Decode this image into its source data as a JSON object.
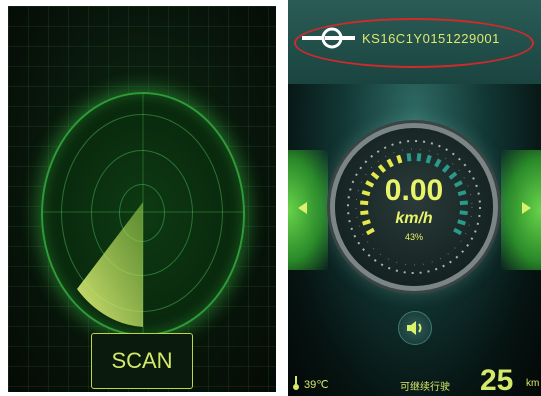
{
  "left_screen": {
    "scan_label": "SCAN"
  },
  "right_screen": {
    "device_id": "KS16C1Y0151229001",
    "speed": {
      "value": "0.00",
      "unit": "km/h",
      "battery_percent": "43%",
      "battery_level": 0.43
    },
    "temperature": "39℃",
    "range_label": "可继续行驶",
    "range_value": "25",
    "range_unit": "km"
  },
  "colors": {
    "accent_yellow": "#d6e86a",
    "radar_green": "#2f9a38",
    "highlight_red": "#d12a2a",
    "panel_teal": "#1a4440"
  },
  "icons": [
    "logo-icon",
    "arrow-left-icon",
    "arrow-right-icon",
    "speaker-icon",
    "thermometer-icon"
  ]
}
